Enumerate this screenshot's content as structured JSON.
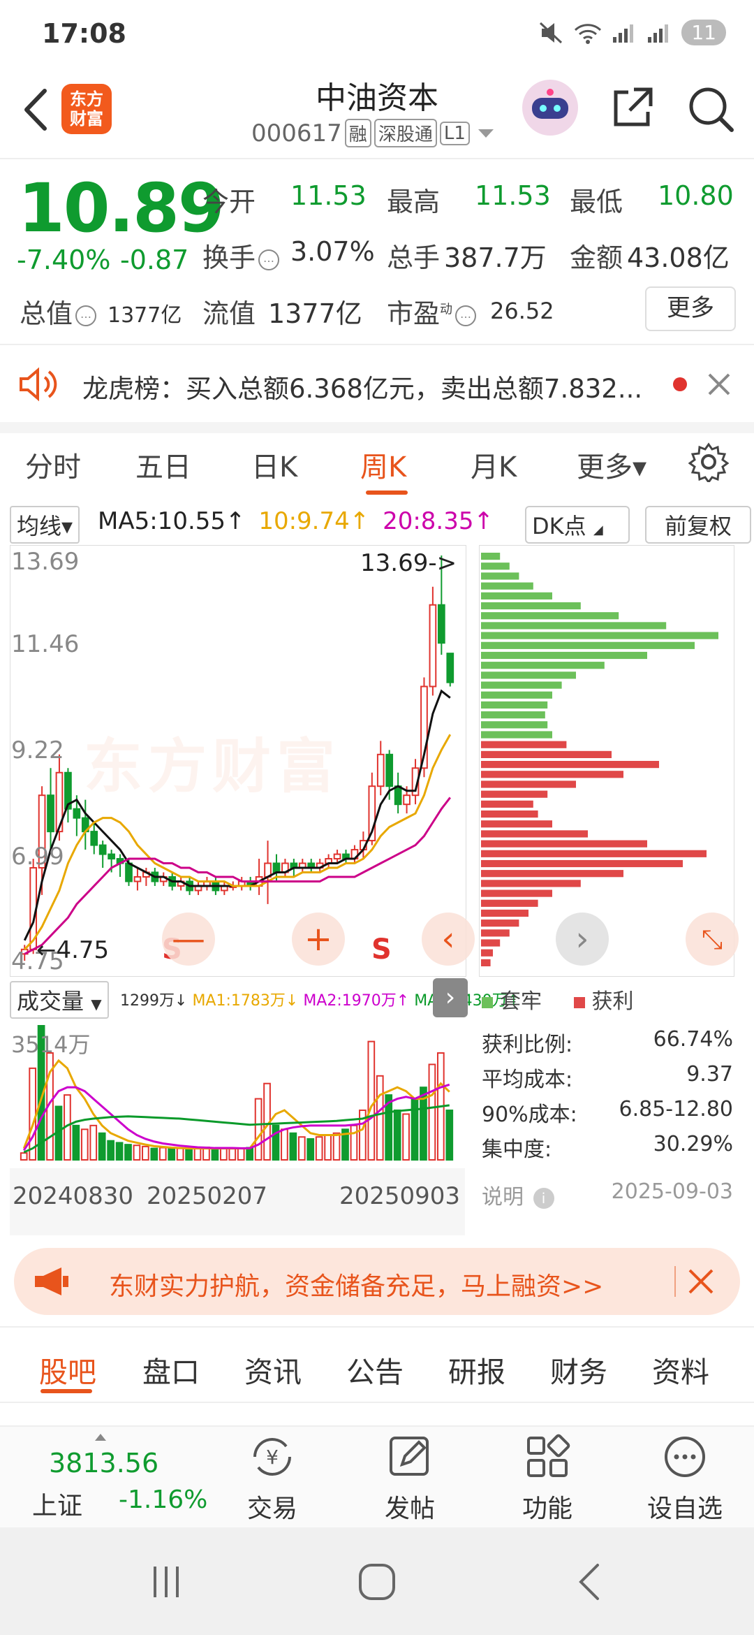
{
  "status_bar": {
    "time": "17:08",
    "battery": "11"
  },
  "header": {
    "logo_text_1": "东方",
    "logo_text_2": "财富",
    "stock_name": "中油资本",
    "stock_code": "000617",
    "tags": [
      "融",
      "深股通",
      "L1"
    ]
  },
  "quote": {
    "price": "10.89",
    "change_pct": "-7.40%",
    "change_abs": "-0.87",
    "rows": [
      [
        {
          "label": "今开",
          "value": "11.53",
          "color": "green"
        },
        {
          "label": "最高",
          "value": "11.53",
          "color": "green"
        },
        {
          "label": "最低",
          "value": "10.80",
          "color": "green"
        }
      ],
      [
        {
          "label": "换手",
          "value": "3.07%",
          "color": "dark"
        },
        {
          "label": "总手",
          "value": "387.7万",
          "color": "dark"
        },
        {
          "label": "金额",
          "value": "43.08亿",
          "color": "dark"
        }
      ]
    ],
    "total_value_label": "总值",
    "total_value": "1377亿",
    "float_value_label": "流值",
    "float_value": "1377亿",
    "pe_label": "市盈",
    "pe_sup": "动",
    "pe_value": "26.52",
    "more_label": "更多"
  },
  "ticker": {
    "text": "龙虎榜：买入总额6.368亿元，卖出总额7.832..."
  },
  "period_tabs": {
    "items": [
      "分时",
      "五日",
      "日K",
      "周K",
      "月K",
      "更多▾"
    ],
    "active": "周K"
  },
  "ma_bar": {
    "select_label": "均线▾",
    "ma5": "MA5:10.55↑",
    "ma10": "10:9.74↑",
    "ma20": "20:8.35↑",
    "dk_label": "DK点",
    "fq_label": "前复权"
  },
  "kchart": {
    "y_labels": [
      "13.69",
      "11.46",
      "9.22",
      "6.99",
      "4.75"
    ],
    "high_marker": "13.69->",
    "low_marker": "←4.75",
    "watermark": "东方财富",
    "s_marks": [
      "S",
      "S"
    ],
    "buttons": [
      "—",
      "+",
      "‹"
    ],
    "chip_buttons": [
      "›",
      "⤡"
    ]
  },
  "chart_data": {
    "type": "candlestick",
    "title": "周K",
    "ylim": [
      4.75,
      13.69
    ],
    "candles": [
      [
        4.9,
        5.0,
        4.75,
        5.1
      ],
      [
        5.0,
        6.8,
        4.9,
        7.0
      ],
      [
        6.8,
        8.4,
        6.2,
        8.6
      ],
      [
        8.4,
        7.6,
        7.2,
        9.0
      ],
      [
        7.6,
        8.9,
        7.4,
        9.3
      ],
      [
        8.9,
        8.1,
        7.8,
        9.0
      ],
      [
        8.1,
        7.9,
        7.5,
        8.4
      ],
      [
        7.9,
        7.6,
        7.2,
        8.3
      ],
      [
        7.6,
        7.3,
        7.1,
        7.8
      ],
      [
        7.3,
        7.1,
        6.8,
        7.4
      ],
      [
        7.1,
        7.0,
        6.7,
        7.2
      ],
      [
        7.0,
        6.9,
        6.6,
        7.1
      ],
      [
        6.9,
        6.5,
        6.4,
        7.0
      ],
      [
        6.5,
        6.6,
        6.3,
        6.8
      ],
      [
        6.6,
        6.7,
        6.4,
        6.8
      ],
      [
        6.7,
        6.5,
        6.4,
        6.8
      ],
      [
        6.5,
        6.6,
        6.4,
        6.7
      ],
      [
        6.6,
        6.4,
        6.3,
        6.7
      ],
      [
        6.4,
        6.5,
        6.3,
        6.6
      ],
      [
        6.5,
        6.3,
        6.2,
        6.6
      ],
      [
        6.3,
        6.4,
        6.2,
        6.5
      ],
      [
        6.4,
        6.5,
        6.3,
        6.6
      ],
      [
        6.5,
        6.3,
        6.2,
        6.6
      ],
      [
        6.3,
        6.4,
        6.2,
        6.5
      ],
      [
        6.4,
        6.4,
        6.3,
        6.5
      ],
      [
        6.4,
        6.5,
        6.3,
        6.6
      ],
      [
        6.5,
        6.4,
        6.3,
        6.6
      ],
      [
        6.4,
        6.6,
        6.2,
        7.0
      ],
      [
        6.6,
        6.9,
        6.0,
        7.4
      ],
      [
        6.9,
        6.7,
        6.5,
        7.1
      ],
      [
        6.7,
        6.9,
        6.6,
        7.0
      ],
      [
        6.9,
        6.8,
        6.6,
        7.0
      ],
      [
        6.8,
        6.9,
        6.7,
        7.0
      ],
      [
        6.9,
        6.8,
        6.7,
        7.0
      ],
      [
        6.8,
        6.9,
        6.7,
        7.0
      ],
      [
        6.9,
        7.0,
        6.8,
        7.1
      ],
      [
        7.0,
        7.1,
        6.9,
        7.2
      ],
      [
        7.1,
        7.0,
        6.9,
        7.2
      ],
      [
        7.0,
        7.2,
        6.9,
        7.3
      ],
      [
        7.2,
        7.4,
        7.0,
        7.6
      ],
      [
        7.4,
        8.6,
        7.3,
        8.9
      ],
      [
        8.6,
        9.3,
        8.4,
        9.6
      ],
      [
        9.3,
        8.6,
        8.3,
        9.4
      ],
      [
        8.6,
        8.2,
        8.0,
        8.9
      ],
      [
        8.2,
        8.4,
        8.0,
        8.6
      ],
      [
        8.4,
        9.0,
        8.2,
        9.2
      ],
      [
        9.0,
        10.8,
        8.8,
        11.0
      ],
      [
        10.8,
        12.6,
        10.6,
        13.0
      ],
      [
        12.6,
        11.76,
        11.5,
        13.69
      ],
      [
        11.53,
        10.89,
        10.8,
        11.53
      ]
    ],
    "ma5": [
      5.2,
      5.6,
      6.5,
      7.2,
      7.7,
      8.2,
      8.3,
      8.0,
      7.8,
      7.6,
      7.4,
      7.2,
      6.9,
      6.8,
      6.7,
      6.6,
      6.6,
      6.5,
      6.5,
      6.4,
      6.4,
      6.4,
      6.4,
      6.4,
      6.4,
      6.4,
      6.4,
      6.5,
      6.6,
      6.7,
      6.7,
      6.8,
      6.8,
      6.8,
      6.8,
      6.9,
      6.9,
      7.0,
      7.0,
      7.2,
      7.6,
      8.2,
      8.5,
      8.6,
      8.5,
      8.5,
      9.3,
      10.2,
      10.7,
      10.55
    ],
    "ma10": [
      5.0,
      5.2,
      5.5,
      5.9,
      6.3,
      6.9,
      7.3,
      7.6,
      7.8,
      7.9,
      7.9,
      7.8,
      7.6,
      7.3,
      7.1,
      6.9,
      6.8,
      6.7,
      6.6,
      6.6,
      6.5,
      6.5,
      6.5,
      6.5,
      6.4,
      6.4,
      6.4,
      6.4,
      6.5,
      6.6,
      6.6,
      6.6,
      6.7,
      6.7,
      6.7,
      6.8,
      6.8,
      6.9,
      6.9,
      7.0,
      7.2,
      7.5,
      7.7,
      7.8,
      7.9,
      8.0,
      8.4,
      9.0,
      9.4,
      9.74
    ],
    "ma20": [
      4.9,
      5.0,
      5.1,
      5.3,
      5.5,
      5.7,
      6.0,
      6.2,
      6.4,
      6.6,
      6.8,
      6.9,
      7.0,
      7.0,
      7.0,
      7.0,
      6.9,
      6.9,
      6.8,
      6.8,
      6.7,
      6.7,
      6.6,
      6.6,
      6.6,
      6.5,
      6.5,
      6.5,
      6.5,
      6.5,
      6.5,
      6.5,
      6.5,
      6.5,
      6.5,
      6.6,
      6.6,
      6.6,
      6.6,
      6.7,
      6.8,
      6.9,
      7.0,
      7.1,
      7.2,
      7.3,
      7.5,
      7.8,
      8.1,
      8.35
    ]
  },
  "volume": {
    "select_label": "成交量",
    "legend": [
      {
        "text": "1299万↓",
        "color": "#333333"
      },
      {
        "text": "MA1:1783万↓",
        "color": "#e8a800"
      },
      {
        "text": "MA2:1970万↑",
        "color": "#cc00cc"
      },
      {
        "text": "MA3:1430万↑",
        "color": "#0a9a2a"
      }
    ],
    "top_label": "3514万",
    "dates": [
      "20240830",
      "20250207",
      "20250903"
    ],
    "bars": [
      {
        "v": 180,
        "up": true
      },
      {
        "v": 2400,
        "up": true
      },
      {
        "v": 3514,
        "up": false
      },
      {
        "v": 2800,
        "up": true
      },
      {
        "v": 1400,
        "up": false
      },
      {
        "v": 1700,
        "up": true
      },
      {
        "v": 900,
        "up": false
      },
      {
        "v": 800,
        "up": true
      },
      {
        "v": 900,
        "up": true
      },
      {
        "v": 700,
        "up": false
      },
      {
        "v": 500,
        "up": false
      },
      {
        "v": 450,
        "up": false
      },
      {
        "v": 400,
        "up": false
      },
      {
        "v": 380,
        "up": true
      },
      {
        "v": 350,
        "up": true
      },
      {
        "v": 300,
        "up": false
      },
      {
        "v": 320,
        "up": true
      },
      {
        "v": 300,
        "up": false
      },
      {
        "v": 300,
        "up": true
      },
      {
        "v": 320,
        "up": false
      },
      {
        "v": 300,
        "up": true
      },
      {
        "v": 330,
        "up": true
      },
      {
        "v": 310,
        "up": false
      },
      {
        "v": 300,
        "up": true
      },
      {
        "v": 290,
        "up": true
      },
      {
        "v": 300,
        "up": true
      },
      {
        "v": 320,
        "up": false
      },
      {
        "v": 1600,
        "up": true
      },
      {
        "v": 2000,
        "up": true
      },
      {
        "v": 900,
        "up": false
      },
      {
        "v": 800,
        "up": true
      },
      {
        "v": 700,
        "up": false
      },
      {
        "v": 600,
        "up": true
      },
      {
        "v": 550,
        "up": false
      },
      {
        "v": 600,
        "up": true
      },
      {
        "v": 650,
        "up": true
      },
      {
        "v": 700,
        "up": true
      },
      {
        "v": 800,
        "up": false
      },
      {
        "v": 900,
        "up": true
      },
      {
        "v": 1300,
        "up": true
      },
      {
        "v": 3100,
        "up": true
      },
      {
        "v": 2200,
        "up": true
      },
      {
        "v": 1700,
        "up": false
      },
      {
        "v": 1300,
        "up": false
      },
      {
        "v": 1200,
        "up": true
      },
      {
        "v": 1600,
        "up": false
      },
      {
        "v": 1900,
        "up": false
      },
      {
        "v": 2500,
        "up": true
      },
      {
        "v": 2800,
        "up": true
      },
      {
        "v": 1299,
        "up": false
      }
    ],
    "vol_ma1": [
      300,
      900,
      1600,
      2300,
      2600,
      2400,
      1900,
      1600,
      1200,
      900,
      700,
      600,
      500,
      450,
      400,
      360,
      340,
      320,
      310,
      300,
      300,
      300,
      300,
      300,
      300,
      300,
      300,
      600,
      900,
      1200,
      1300,
      1100,
      900,
      700,
      650,
      650,
      650,
      680,
      700,
      800,
      1400,
      1700,
      1800,
      1900,
      1800,
      1600,
      1600,
      1700,
      2000,
      1783
    ],
    "vol_ma2": [
      250,
      600,
      1100,
      1500,
      1800,
      1900,
      1900,
      1800,
      1600,
      1400,
      1200,
      1000,
      800,
      650,
      550,
      480,
      430,
      400,
      370,
      350,
      330,
      320,
      310,
      310,
      310,
      305,
      305,
      400,
      550,
      700,
      800,
      850,
      880,
      900,
      900,
      900,
      900,
      900,
      920,
      950,
      1100,
      1300,
      1500,
      1600,
      1650,
      1600,
      1700,
      1800,
      1900,
      1970
    ],
    "vol_ma3": [
      200,
      300,
      450,
      600,
      750,
      900,
      1000,
      1050,
      1080,
      1100,
      1120,
      1130,
      1140,
      1130,
      1120,
      1110,
      1100,
      1090,
      1080,
      1060,
      1040,
      1020,
      1000,
      980,
      960,
      940,
      920,
      930,
      940,
      950,
      960,
      970,
      980,
      990,
      1000,
      1010,
      1020,
      1040,
      1060,
      1080,
      1150,
      1200,
      1250,
      1280,
      1300,
      1320,
      1340,
      1370,
      1400,
      1430
    ]
  },
  "chips": {
    "distribution": [
      {
        "len": 0.08,
        "profit": false
      },
      {
        "len": 0.12,
        "profit": false
      },
      {
        "len": 0.16,
        "profit": false
      },
      {
        "len": 0.22,
        "profit": false
      },
      {
        "len": 0.3,
        "profit": false
      },
      {
        "len": 0.42,
        "profit": false
      },
      {
        "len": 0.58,
        "profit": false
      },
      {
        "len": 0.78,
        "profit": false
      },
      {
        "len": 1.0,
        "profit": false
      },
      {
        "len": 0.9,
        "profit": false
      },
      {
        "len": 0.7,
        "profit": false
      },
      {
        "len": 0.52,
        "profit": false
      },
      {
        "len": 0.4,
        "profit": false
      },
      {
        "len": 0.34,
        "profit": false
      },
      {
        "len": 0.3,
        "profit": false
      },
      {
        "len": 0.28,
        "profit": false
      },
      {
        "len": 0.27,
        "profit": false
      },
      {
        "len": 0.28,
        "profit": false
      },
      {
        "len": 0.3,
        "profit": false
      },
      {
        "len": 0.36,
        "profit": true
      },
      {
        "len": 0.55,
        "profit": true
      },
      {
        "len": 0.75,
        "profit": true
      },
      {
        "len": 0.6,
        "profit": true
      },
      {
        "len": 0.4,
        "profit": true
      },
      {
        "len": 0.28,
        "profit": true
      },
      {
        "len": 0.22,
        "profit": true
      },
      {
        "len": 0.24,
        "profit": true
      },
      {
        "len": 0.3,
        "profit": true
      },
      {
        "len": 0.45,
        "profit": true
      },
      {
        "len": 0.7,
        "profit": true
      },
      {
        "len": 0.95,
        "profit": true
      },
      {
        "len": 0.85,
        "profit": true
      },
      {
        "len": 0.6,
        "profit": true
      },
      {
        "len": 0.42,
        "profit": true
      },
      {
        "len": 0.3,
        "profit": true
      },
      {
        "len": 0.24,
        "profit": true
      },
      {
        "len": 0.2,
        "profit": true
      },
      {
        "len": 0.16,
        "profit": true
      },
      {
        "len": 0.12,
        "profit": true
      },
      {
        "len": 0.08,
        "profit": true
      },
      {
        "len": 0.05,
        "profit": true
      },
      {
        "len": 0.04,
        "profit": true
      }
    ],
    "legend_trapped": "套牢",
    "legend_profit": "获利",
    "stats": [
      {
        "label": "获利比例:",
        "value": "66.74%"
      },
      {
        "label": "平均成本:",
        "value": "9.37"
      },
      {
        "label": "90%成本:",
        "value": "6.85-12.80"
      },
      {
        "label": "集中度:",
        "value": "30.29%"
      }
    ],
    "note_label": "说明",
    "date": "2025-09-03"
  },
  "promo": {
    "text": "东财实力护航，资金储备充足，马上融资>>"
  },
  "bottom_tabs": {
    "items": [
      "股吧",
      "盘口",
      "资讯",
      "公告",
      "研报",
      "财务",
      "资料"
    ],
    "active": "股吧"
  },
  "bottom_nav": {
    "index_value": "3813.56",
    "index_name": "上证",
    "index_pct": "-1.16%",
    "items": [
      {
        "label": "交易",
        "icon": "yen-exchange-icon"
      },
      {
        "label": "发帖",
        "icon": "compose-icon"
      },
      {
        "label": "功能",
        "icon": "grid-icon"
      },
      {
        "label": "设自选",
        "icon": "more-dots-icon"
      }
    ]
  },
  "colors": {
    "up": "#e0332e",
    "down": "#0f9b2f",
    "accent": "#e8541c"
  }
}
